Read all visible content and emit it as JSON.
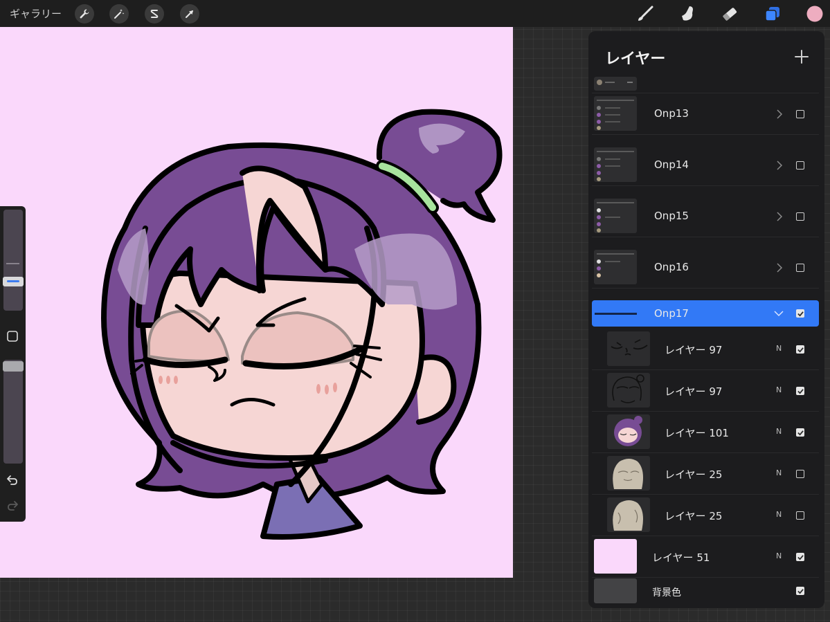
{
  "topbar": {
    "gallery_label": "ギャラリー",
    "left_tools": [
      {
        "name": "actions",
        "icon": "wrench-icon"
      },
      {
        "name": "adjustments",
        "icon": "magic-wand-icon"
      },
      {
        "name": "selection",
        "icon": "selection-s-icon"
      },
      {
        "name": "transform",
        "icon": "arrow-cursor-icon"
      }
    ],
    "right_tools": [
      {
        "name": "brush",
        "icon": "brush-icon"
      },
      {
        "name": "smudge",
        "icon": "smudge-icon"
      },
      {
        "name": "eraser",
        "icon": "eraser-icon"
      },
      {
        "name": "layers",
        "icon": "layers-icon",
        "active": true
      },
      {
        "name": "color",
        "icon": "color-swatch-icon",
        "color": "#eeadc0"
      }
    ]
  },
  "sidebar": {
    "brush_size_level": 0.2,
    "opacity_level": 1.0,
    "accent": "#3d7cf0"
  },
  "layers_panel": {
    "title": "レイヤー",
    "add_icon": "plus-icon",
    "layers": [
      {
        "label": "",
        "type": "group-partial",
        "checked": false
      },
      {
        "label": "Onp13",
        "type": "group",
        "checked": false
      },
      {
        "label": "Onp14",
        "type": "group",
        "checked": false
      },
      {
        "label": "Onp15",
        "type": "group",
        "checked": false
      },
      {
        "label": "Onp16",
        "type": "group",
        "checked": false
      },
      {
        "label": "Onp17",
        "type": "group-open",
        "selected": true,
        "checked": true
      },
      {
        "label": "レイヤー 97",
        "mode": "N",
        "checked": true,
        "thumb": "face-lines"
      },
      {
        "label": "レイヤー 97",
        "mode": "N",
        "checked": true,
        "thumb": "hair-lines"
      },
      {
        "label": "レイヤー 101",
        "mode": "N",
        "checked": true,
        "thumb": "character"
      },
      {
        "label": "レイヤー 25",
        "mode": "N",
        "checked": false,
        "thumb": "sketch"
      },
      {
        "label": "レイヤー 25",
        "mode": "N",
        "checked": false,
        "thumb": "sketch"
      },
      {
        "label": "レイヤー 51",
        "mode": "N",
        "checked": true,
        "thumb": "pink"
      },
      {
        "label": "背景色",
        "mode": "",
        "checked": true,
        "thumb": "bg"
      }
    ]
  },
  "colors": {
    "canvas_bg": "#fad8fb",
    "hair": "#784c94",
    "skin": "#f6d6d4",
    "selected_row": "#3279f6"
  }
}
